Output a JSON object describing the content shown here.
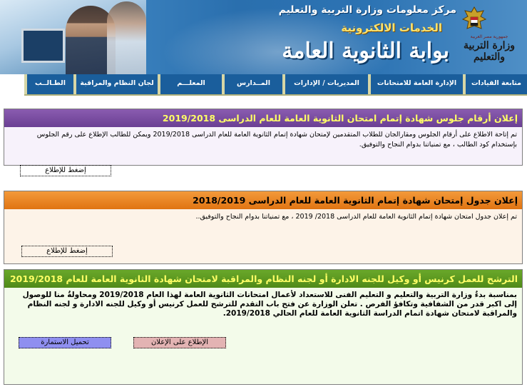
{
  "header": {
    "center_title": "مركز معلومات وزارة التربية والتعليم",
    "services_title": "الخدمات الالكترونية",
    "portal_title": "بوابة الثانوية العامة",
    "ministry_name": "وزارة التربية والتعليم",
    "ministry_sub": "جمهورية مصر العربية"
  },
  "nav": {
    "items": [
      "متابعة القيادات",
      "الإدارة العامة للامتحانات",
      "المديريات / الإدارات",
      "المــدارس",
      "المعلـــم",
      "لجان النظام والمراقبة",
      "الطـالــب"
    ]
  },
  "announcements": [
    {
      "title": "إعلان أرقام جلوس شهادة إتمام امتحان الثانوية العامة للعام الدراسى 2019/2018",
      "body": "تم إتاحة الاطلاع على أرقام الجلوس ومقارالجان للطلاب المتقدمين لإمتحان شهادة إتمام الثانوية العامة للعام الدراسى 2019/2018 ويمكن للطالب الإطلاع على رقم الجلوس بإستخدام كود الطالب ، مع تمنياتنا بدوام النجاح والتوفيق.",
      "button": "إضغط للإطلاع"
    },
    {
      "title": "إعلان جدول إمتحان شهادة إتمام الثانوية العامة للعام الدراسى 2018/2019",
      "body": "تم إعلان جدول امتحان شهادة إتمام الثانوية العامة للعام الدراسى 2018/ 2019 ، مع تمنياتنا بدوام النجاح والتوفيق..",
      "button": "إضغط للإطلاع"
    },
    {
      "title": "الترشح للعمل كرنيس أو وكيل للجنه الادارة أو لجنه النظام والمراقبة لامتحان شهادة الثانوية العامة للعام 2019/2018",
      "body": "بمناسبة بدءٌ وزارة التربية والتعليم و التعليم الفنى للاستعداد لأعمال امتحانات الثانوية العامة لهذا العام 2019/2018 ومحاولةٌ منا للوصول إلى اكبر قدر من الشفافية وتكافؤ الفرص . تعلن الوزارة عن فتح باب التقدم للترشح للعمل كرنيس أو وكيل للجنه الادارة و لجنه النظام والمراقبة لامتحان شهادة اتمام الدراسة الثانوية العامة للعام الحالي 2019/2018.",
      "button_view": "الإطلاع على الإعلان",
      "button_download": "تحميل الاستمارة"
    }
  ],
  "colors": {
    "nav_item_bg": "#1a5e9c",
    "box1_header": "#6a3f93",
    "box2_header": "#e07412",
    "box3_header": "#4f8a18",
    "header_title_yellow": "#ffff66"
  }
}
